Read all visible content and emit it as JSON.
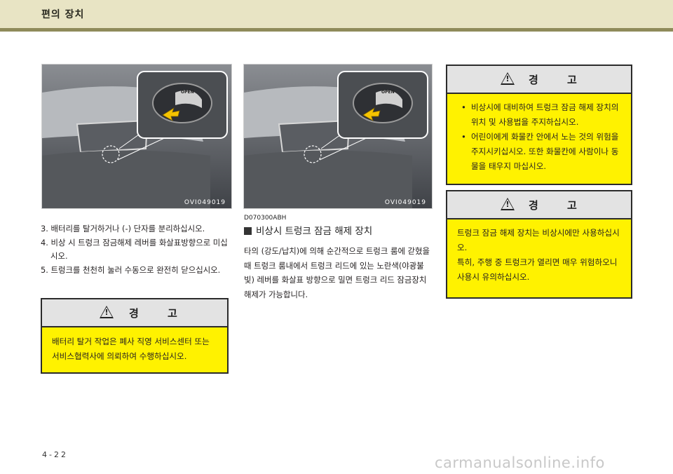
{
  "header": {
    "title": "편의 장치"
  },
  "photos": [
    {
      "code": "OVI049019",
      "button_label": "OPEN"
    },
    {
      "code": "OVI049019",
      "button_label": "OPEN"
    }
  ],
  "steps": [
    "3. 배터리를 탈거하거나 (-) 단자를 분리하십시오.",
    "4. 비상 시 트렁크 잠금해제 레버를 화살표방향으로 미십시오.",
    "5. 트렁크를 천천히 눌러 수동으로 완전히 닫으십시오."
  ],
  "warning_left": {
    "title": "경 고",
    "text": "배터리 탈거 작업은 폐사 직영 서비스센터 또는 서비스협력사에 의뢰하여 수행하십시오."
  },
  "section": {
    "code": "D070300ABH",
    "title": "비상시 트렁크 잠금 해제 장치",
    "body": "타의 (강도/납치)에 의해 순간적으로 트렁크 룸에 갇혔을 때 트렁크 룸내에서 트렁크 리드에 있는 노란색(야광불빛) 레버를 화살표 방향으로 밀면 트렁크 리드 잠금장치 해제가 가능합니다."
  },
  "warning_right_1": {
    "title": "경 고",
    "bullets": [
      "비상시에 대비하여 트렁크 잠금 해제 장치의 위치 및 사용법을 주지하십시오.",
      "어린이에게 화물칸 안에서 노는 것의 위험을 주지시키십시오. 또한 화물칸에 사람이나 동물을 태우지 마십시오."
    ]
  },
  "warning_right_2": {
    "title": "경 고",
    "lines": [
      "트렁크 잠금 해제 장치는 비상시에만 사용하십시오.",
      "특히, 주행 중 트렁크가 열리면 매우 위험하오니 사용시 유의하십시오."
    ]
  },
  "page_number": "4-22",
  "watermark": "carmanualsonline.info"
}
